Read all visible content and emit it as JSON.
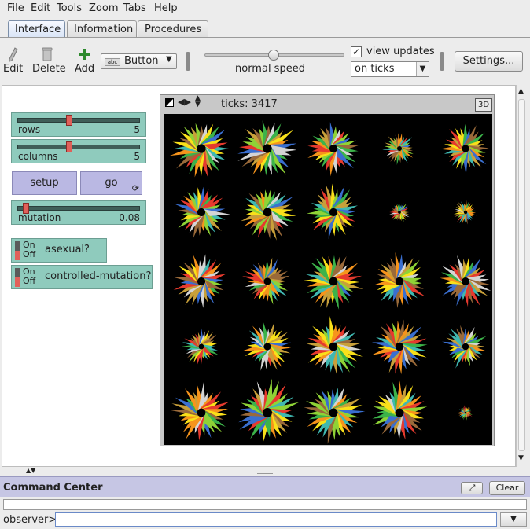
{
  "menu": [
    "File",
    "Edit",
    "Tools",
    "Zoom",
    "Tabs",
    "Help"
  ],
  "tabs": [
    {
      "label": "Interface",
      "active": true
    },
    {
      "label": "Information",
      "active": false
    },
    {
      "label": "Procedures",
      "active": false
    }
  ],
  "toolbar": {
    "edit_label": "Edit",
    "delete_label": "Delete",
    "add_label": "Add",
    "widget_type": "Button",
    "widget_icon_text": "abc",
    "speed_label": "normal speed",
    "view_updates_label": "view updates",
    "view_updates_checked": true,
    "update_mode": "on ticks",
    "settings_label": "Settings..."
  },
  "widgets": {
    "rows": {
      "label": "rows",
      "value": "5",
      "fraction": 0.42
    },
    "columns": {
      "label": "columns",
      "value": "5",
      "fraction": 0.42
    },
    "setup_label": "setup",
    "go_label": "go",
    "mutation": {
      "label": "mutation",
      "value": "0.08",
      "fraction": 0.05
    },
    "switch_on": "On",
    "switch_off": "Off",
    "asexual_label": "asexual?",
    "controlled_mutation_label": "controlled-mutation?"
  },
  "view": {
    "ticks_text": "ticks: 3417",
    "three_d_label": "3D",
    "palette": [
      "#e63a2e",
      "#f6941c",
      "#f9e01a",
      "#8fd336",
      "#3cb34a",
      "#40b8b0",
      "#3a6fd0",
      "#c8a03a",
      "#d4d4d4",
      "#9a6a3a"
    ]
  },
  "command_center": {
    "title": "Command Center",
    "clear_label": "Clear",
    "prompt": "observer>"
  }
}
